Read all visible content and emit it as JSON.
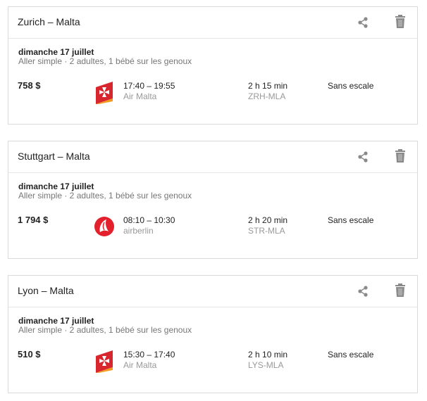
{
  "cards": [
    {
      "route": "Zurich – Malta",
      "date": "dimanche 17 juillet",
      "details": "Aller simple · 2 adultes, 1 bébé sur les genoux",
      "price": "758 $",
      "times": "17:40 – 19:55",
      "airline": "Air Malta",
      "logo": "air-malta",
      "duration": "2 h 15 min",
      "airports": "ZRH-MLA",
      "stops": "Sans escale"
    },
    {
      "route": "Stuttgart – Malta",
      "date": "dimanche 17 juillet",
      "details": "Aller simple · 2 adultes, 1 bébé sur les genoux",
      "price": "1 794 $",
      "times": "08:10 – 10:30",
      "airline": "airberlin",
      "logo": "airberlin",
      "duration": "2 h 20 min",
      "airports": "STR-MLA",
      "stops": "Sans escale"
    },
    {
      "route": "Lyon – Malta",
      "date": "dimanche 17 juillet",
      "details": "Aller simple · 2 adultes, 1 bébé sur les genoux",
      "price": "510 $",
      "times": "15:30 – 17:40",
      "airline": "Air Malta",
      "logo": "air-malta",
      "duration": "2 h 10 min",
      "airports": "LYS-MLA",
      "stops": "Sans escale"
    }
  ],
  "icons": {
    "share": "share-icon",
    "delete": "trash-icon"
  },
  "colors": {
    "air_malta_red": "#d8262f",
    "air_malta_orange": "#f39a1e",
    "airberlin_red": "#e3202b",
    "icon_gray": "#8a8a8a",
    "muted_text": "#777777",
    "secondary_text": "#999999"
  }
}
